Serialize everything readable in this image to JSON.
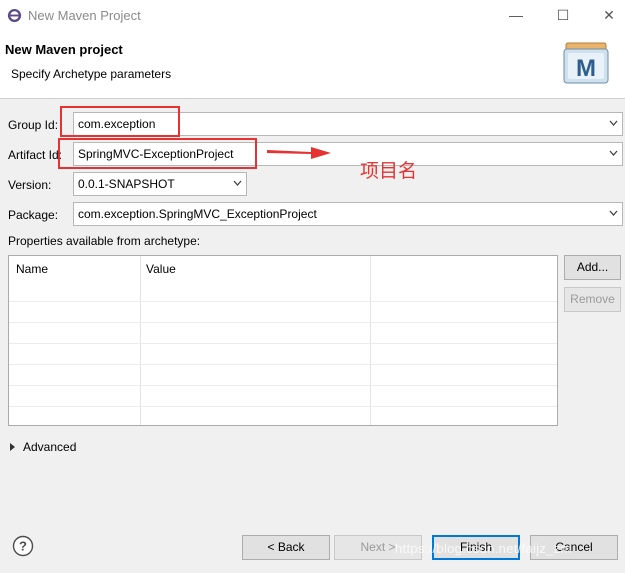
{
  "window": {
    "title": "New Maven Project",
    "controls": {
      "minimize": "—",
      "maximize": "☐",
      "close": "✕"
    }
  },
  "header": {
    "title": "New Maven project",
    "subtitle": "Specify Archetype parameters"
  },
  "form": {
    "group_id": {
      "label": "Group Id:",
      "value": "com.exception"
    },
    "artifact_id": {
      "label": "Artifact Id:",
      "value": "SpringMVC-ExceptionProject"
    },
    "version": {
      "label": "Version:",
      "value": "0.0.1-SNAPSHOT"
    },
    "package": {
      "label": "Package:",
      "value": "com.exception.SpringMVC_ExceptionProject"
    }
  },
  "annotation": {
    "text": "项目名",
    "color": "#e53333"
  },
  "properties": {
    "label": "Properties available from archetype:",
    "columns": [
      "Name",
      "Value"
    ],
    "rows": []
  },
  "buttons": {
    "add": "Add...",
    "remove": "Remove",
    "back": "< Back",
    "next": "Next >",
    "finish": "Finish",
    "cancel": "Cancel"
  },
  "advanced": {
    "label": "Advanced"
  },
  "watermark": "https://blog.csdn.net/faijz_zm",
  "colors": {
    "accent": "#0078d7",
    "annotation_red": "#e53333"
  }
}
